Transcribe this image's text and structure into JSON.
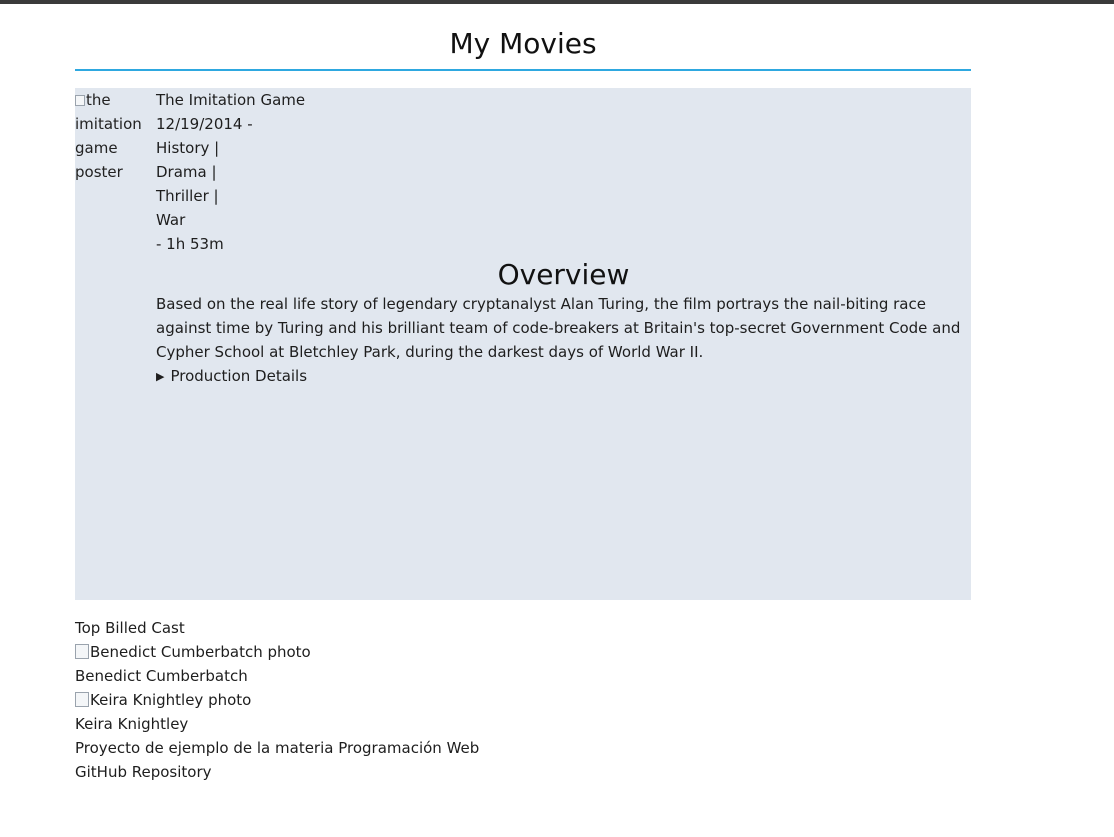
{
  "site": {
    "title": "My Movies"
  },
  "movie": {
    "poster_alt": [
      "the",
      "imitation",
      "game",
      "poster"
    ],
    "title": "The Imitation Game",
    "release_date": "12/19/2014 -",
    "genres": [
      "History |",
      "Drama |",
      "Thriller |",
      "War"
    ],
    "runtime": "- 1h 53m",
    "overview_heading": "Overview",
    "overview": "Based on the real life story of legendary cryptanalyst Alan Turing, the film portrays the nail-biting race against time by Turing and his brilliant team of code-breakers at Britain's top-secret Government Code and Cypher School at Bletchley Park, during the darkest days of World War II.",
    "details_summary": "Production Details"
  },
  "cast": {
    "heading": "Top Billed Cast",
    "members": [
      {
        "photo_alt": "Benedict Cumberbatch photo",
        "name": "Benedict Cumberbatch"
      },
      {
        "photo_alt": "Keira Knightley photo",
        "name": "Keira Knightley"
      }
    ]
  },
  "footer": {
    "note": "Proyecto de ejemplo de la materia Programación Web",
    "repo_link": "GitHub Repository"
  },
  "colors": {
    "accent_rule": "#2ea8e0",
    "card_background": "#e1e7ef",
    "top_bar": "#3a3a3a"
  },
  "icons": {
    "broken_image": "broken-image-icon",
    "disclosure": "disclosure-triangle-icon"
  }
}
